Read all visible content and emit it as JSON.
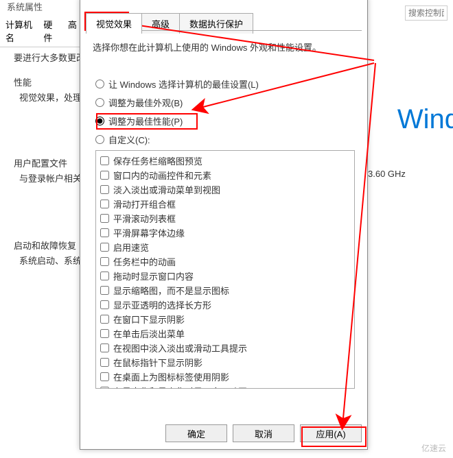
{
  "bg": {
    "title": "系统属性",
    "tabs": [
      "计算机名",
      "硬件",
      "高"
    ],
    "search_placeholder": "搜索控制面",
    "row_main": "要进行大多数更改",
    "sec_perf": "性能",
    "sec_perf_desc": "视觉效果，处理器",
    "sec_user": "用户配置文件",
    "sec_user_desc": "与登录帐户相关的",
    "sec_start": "启动和故障恢复",
    "sec_start_desc": "系统启动、系统故",
    "wind": "Wind",
    "ghz": "3.60 GHz"
  },
  "dialog": {
    "tabs": {
      "visual": "视觉效果",
      "advanced": "高级",
      "dep": "数据执行保护"
    },
    "desc": "选择你想在此计算机上使用的 Windows 外观和性能设置。",
    "radios": {
      "r1": "让 Windows 选择计算机的最佳设置(L)",
      "r2": "调整为最佳外观(B)",
      "r3": "调整为最佳性能(P)",
      "r4": "自定义(C):"
    },
    "checks": [
      "保存任务栏缩略图预览",
      "窗口内的动画控件和元素",
      "淡入淡出或滑动菜单到视图",
      "滑动打开组合框",
      "平滑滚动列表框",
      "平滑屏幕字体边缘",
      "启用速览",
      "任务栏中的动画",
      "拖动时显示窗口内容",
      "显示缩略图，而不是显示图标",
      "显示亚透明的选择长方形",
      "在窗口下显示阴影",
      "在单击后淡出菜单",
      "在视图中淡入淡出或滑动工具提示",
      "在鼠标指针下显示阴影",
      "在桌面上为图标标签使用阴影",
      "在最大化和最小化时显示窗口动画"
    ],
    "buttons": {
      "ok": "确定",
      "cancel": "取消",
      "apply": "应用(A)"
    }
  },
  "watermark": "亿速云"
}
